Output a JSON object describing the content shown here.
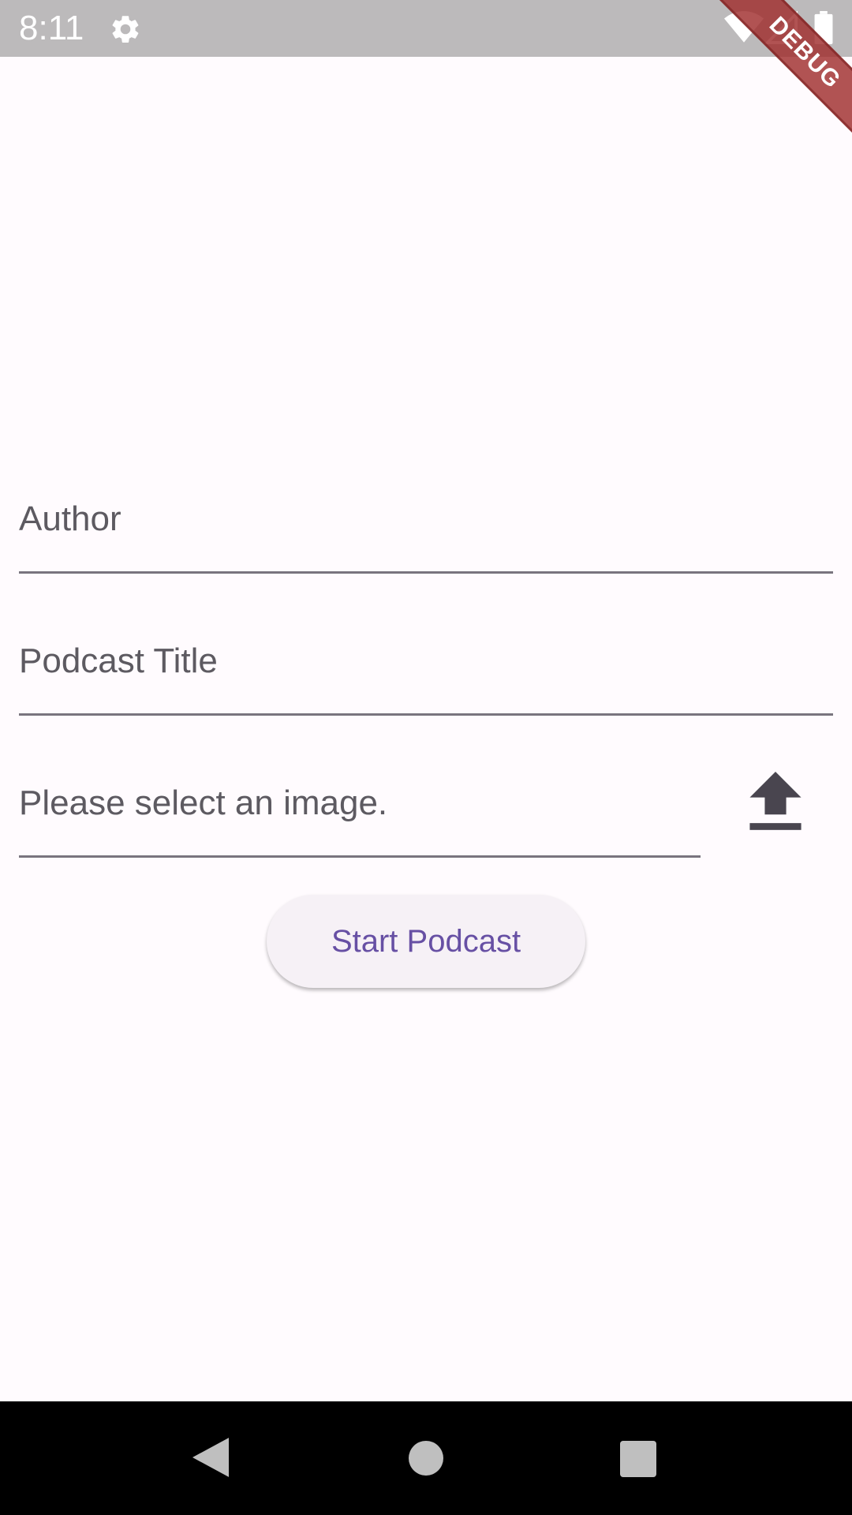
{
  "status_bar": {
    "time": "8:11",
    "icons": [
      "gear-icon",
      "wifi-icon",
      "signal-icon",
      "battery-icon"
    ]
  },
  "debug_banner": {
    "label": "DEBUG",
    "color": "#a02d2d"
  },
  "form": {
    "author": {
      "label": "Author"
    },
    "podcast_title": {
      "label": "Podcast Title"
    },
    "image": {
      "label": "Please select an image.",
      "upload_icon": "upload-icon"
    },
    "start_button_label": "Start Podcast"
  },
  "nav_bar": {
    "icons": [
      "back-icon",
      "home-icon",
      "recents-icon"
    ]
  },
  "colors": {
    "background": "#fffbfe",
    "accent": "#6750a4",
    "label_text": "#5d5a61",
    "underline": "#79747e",
    "status_bar": "#bcbabb"
  }
}
